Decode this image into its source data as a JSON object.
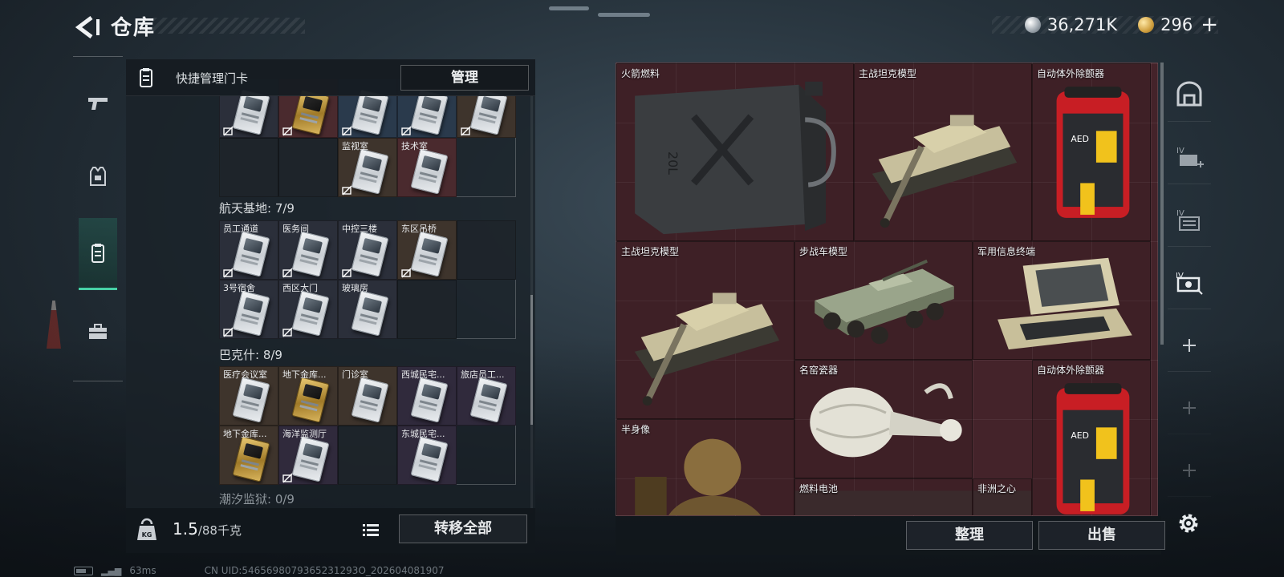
{
  "header": {
    "title": "仓库",
    "silver_amount": "36,271K",
    "gold_amount": "296",
    "plus_label": "+"
  },
  "left_rail": {
    "tabs": [
      {
        "name": "weapons",
        "icon": "pistol-icon"
      },
      {
        "name": "equipment",
        "icon": "armor-vest-icon"
      },
      {
        "name": "keycards",
        "icon": "keycard-holder-icon",
        "active": true
      },
      {
        "name": "supplies",
        "icon": "toolbox-icon"
      }
    ]
  },
  "keycard_bar": {
    "title": "快捷管理门卡",
    "manage_label": "管理"
  },
  "groups": [
    {
      "label": "",
      "rows": [
        [
          {
            "name": "",
            "quality": "grey",
            "card": "silver",
            "locked": true
          },
          {
            "name": "",
            "quality": "red",
            "card": "gold",
            "locked": true
          },
          {
            "name": "",
            "quality": "blue",
            "card": "silver",
            "locked": true
          },
          {
            "name": "",
            "quality": "blue",
            "card": "silver",
            "locked": true
          },
          {
            "name": "",
            "quality": "brown",
            "card": "silver",
            "locked": true
          }
        ],
        [
          {
            "name": "",
            "quality": "empty"
          },
          {
            "name": "",
            "quality": "empty"
          },
          {
            "name": "监视室",
            "quality": "brown",
            "card": "silver",
            "locked": true
          },
          {
            "name": "技术室",
            "quality": "red",
            "card": "silver",
            "locked": false
          }
        ]
      ]
    },
    {
      "label": "航天基地: 7/9",
      "rows": [
        [
          {
            "name": "员工通道",
            "quality": "grey",
            "card": "silver",
            "locked": true
          },
          {
            "name": "医务间",
            "quality": "grey",
            "card": "silver",
            "locked": true
          },
          {
            "name": "中控三楼",
            "quality": "grey",
            "card": "silver",
            "locked": true
          },
          {
            "name": "东区吊桥",
            "quality": "brown",
            "card": "silver",
            "locked": true
          },
          {
            "name": "",
            "quality": "empty"
          }
        ],
        [
          {
            "name": "3号宿舍",
            "quality": "grey",
            "card": "silver",
            "locked": true
          },
          {
            "name": "西区大门",
            "quality": "grey",
            "card": "silver",
            "locked": true
          },
          {
            "name": "玻璃房",
            "quality": "grey",
            "card": "silver",
            "locked": false
          },
          {
            "name": "",
            "quality": "empty"
          }
        ]
      ]
    },
    {
      "label": "巴克什: 8/9",
      "rows": [
        [
          {
            "name": "医疗会议室",
            "quality": "brown",
            "card": "silver",
            "locked": false
          },
          {
            "name": "地下金库...",
            "quality": "brown",
            "card": "gold",
            "locked": false
          },
          {
            "name": "门诊室",
            "quality": "brown",
            "card": "silver",
            "locked": false
          },
          {
            "name": "西城民宅...",
            "quality": "purple",
            "card": "silver",
            "locked": false
          },
          {
            "name": "旅店员工...",
            "quality": "purple",
            "card": "silver",
            "locked": false
          }
        ],
        [
          {
            "name": "地下金库...",
            "quality": "brown",
            "card": "gold",
            "locked": false
          },
          {
            "name": "海洋监测厅",
            "quality": "purple",
            "card": "silver",
            "locked": true
          },
          {
            "name": "",
            "quality": "empty"
          },
          {
            "name": "东城民宅...",
            "quality": "purple",
            "card": "silver",
            "locked": false
          }
        ]
      ]
    },
    {
      "label": "潮汐监狱: 0/9",
      "rows": []
    }
  ],
  "weight": {
    "current": "1.5",
    "max": "/88千克"
  },
  "transfer_all_label": "转移全部",
  "backpack_items": [
    {
      "id": "rocket-fuel",
      "name": "火箭燃料",
      "art": "fuel-can"
    },
    {
      "id": "mbt-model-1",
      "name": "主战坦克模型",
      "art": "tank"
    },
    {
      "id": "aed-1",
      "name": "自动体外除颤器",
      "art": "aed"
    },
    {
      "id": "mbt-model-2",
      "name": "主战坦克模型",
      "art": "tank"
    },
    {
      "id": "ifv-model",
      "name": "步战车模型",
      "art": "ifv"
    },
    {
      "id": "mil-terminal",
      "name": "军用信息终端",
      "art": "terminal"
    },
    {
      "id": "vase",
      "name": "名窑瓷器",
      "art": "vase"
    },
    {
      "id": "aed-2",
      "name": "自动体外除颤器",
      "art": "aed"
    },
    {
      "id": "bust",
      "name": "半身像",
      "art": "bust"
    },
    {
      "id": "fuel-cell",
      "name": "燃料电池",
      "art": "dark"
    },
    {
      "id": "heart",
      "name": "非洲之心",
      "art": "dark"
    }
  ],
  "sort_label": "整理",
  "sell_label": "出售",
  "status": {
    "ping": "63ms",
    "uid": "CN UID:5465698079365231293O_202604081907"
  },
  "colors": {
    "accent": "#47d1a6",
    "backpack_bg": "#44232a"
  }
}
